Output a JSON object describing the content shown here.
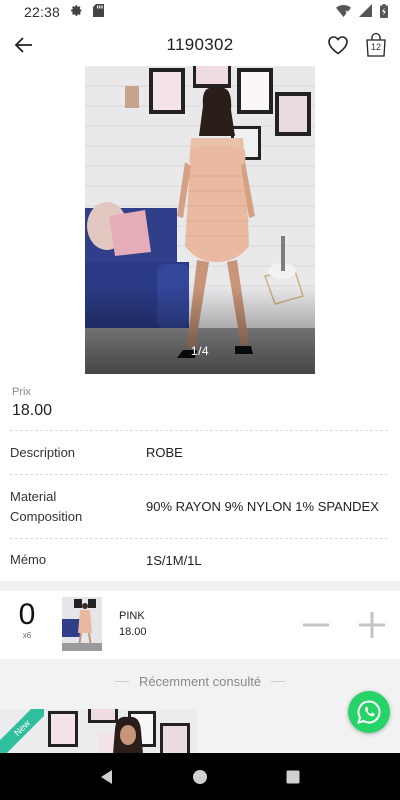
{
  "status_bar": {
    "time": "22:38"
  },
  "header": {
    "title": "1190302",
    "cart_count": "12"
  },
  "gallery": {
    "counter": "1/4"
  },
  "details": {
    "price_label": "Prix",
    "price": "18.00",
    "rows": [
      {
        "label": "Description",
        "value": "ROBE"
      },
      {
        "label": "Material Composition",
        "value": "90% RAYON 9% NYLON 1% SPANDEX"
      },
      {
        "label": "Mémo",
        "value": "1S/1M/1L"
      }
    ]
  },
  "variant": {
    "quantity": "0",
    "multiplier": "x6",
    "color": "PINK",
    "price": "18.00"
  },
  "recent": {
    "title": "Récemment consulté",
    "badge": "New"
  },
  "colors": {
    "badge": "#2fbf9f",
    "whatsapp": "#25d366"
  }
}
